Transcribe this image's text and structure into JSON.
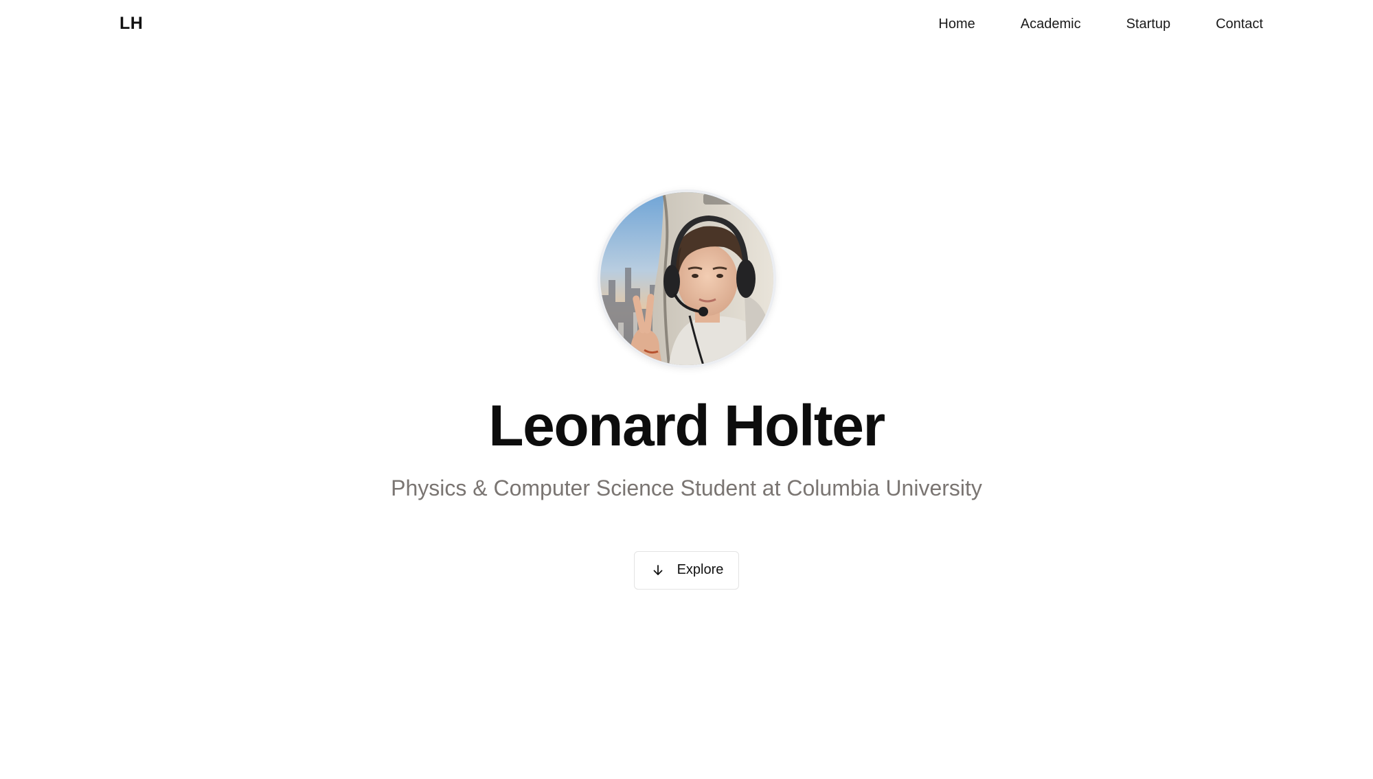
{
  "header": {
    "brand": "LH",
    "nav": [
      {
        "label": "Home"
      },
      {
        "label": "Academic"
      },
      {
        "label": "Startup"
      },
      {
        "label": "Contact"
      }
    ]
  },
  "hero": {
    "avatar_icon": "profile-photo",
    "name": "Leonard Holter",
    "subtitle": "Physics & Computer Science Student at Columbia University",
    "explore_button": {
      "label": "Explore",
      "icon": "arrow-down-icon"
    }
  },
  "colors": {
    "background": "#ffffff",
    "text": "#111111",
    "subtitle": "#7a7572",
    "button_border": "#e3e3e3"
  }
}
